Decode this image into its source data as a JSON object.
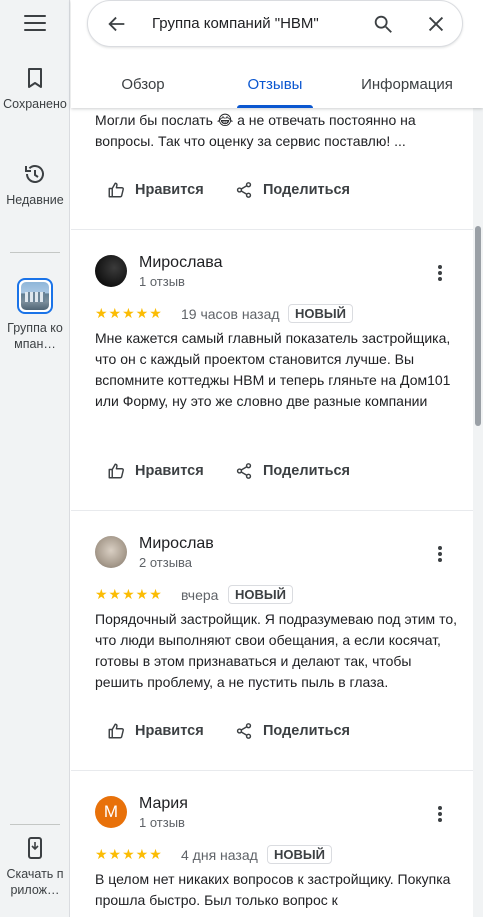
{
  "rail": {
    "saved_label": "Сохранено",
    "recent_label": "Недавние",
    "place_label": "Группа компан…",
    "download_label": "Скачать прилож…"
  },
  "search": {
    "query": "Группа компаний \"НВМ\""
  },
  "tabs": [
    {
      "label": "Обзор",
      "active": false
    },
    {
      "label": "Отзывы",
      "active": true
    },
    {
      "label": "Информация",
      "active": false
    }
  ],
  "actions": {
    "like_label": "Нравится",
    "share_label": "Поделиться"
  },
  "partial_review": {
    "text": "Могли бы послать 😂 а не отвечать постоянно на вопросы. Так что оценку за сервис поставлю! ..."
  },
  "reviews": [
    {
      "name": "Мирослава",
      "count": "1 отзыв",
      "stars": "★★★★★",
      "rating": 5,
      "time": "19 часов назад",
      "badge": "НОВЫЙ",
      "text": "Мне кажется самый главный показатель застройщика, что он с каждый проектом становится лучше. Вы вспомните коттеджы НВМ и теперь гляньте на Дом101 или Форму, ну это же словно две разные компании",
      "avatar_color": "#1e1e1e"
    },
    {
      "name": "Мирослав",
      "count": "2 отзыва",
      "stars": "★★★★★",
      "rating": 5,
      "time": "вчера",
      "badge": "НОВЫЙ",
      "text": "Порядочный застройщик. Я подразумеваю под этим то, что люди выполняют свои обещания, а если косячат, готовы в этом признаваться и делают так, чтобы решить проблему, а не пустить пыль в глаза.",
      "avatar_color": "#b9b0a4"
    },
    {
      "name": "Мария",
      "count": "1 отзыв",
      "stars": "★★★★★",
      "rating": 5,
      "time": "4 дня назад",
      "badge": "НОВЫЙ",
      "text": "В целом нет никаких вопросов к застройщику. Покупка прошла быстро. Был только вопрос к",
      "avatar_letter": "М",
      "avatar_color": "#e8710a"
    }
  ]
}
